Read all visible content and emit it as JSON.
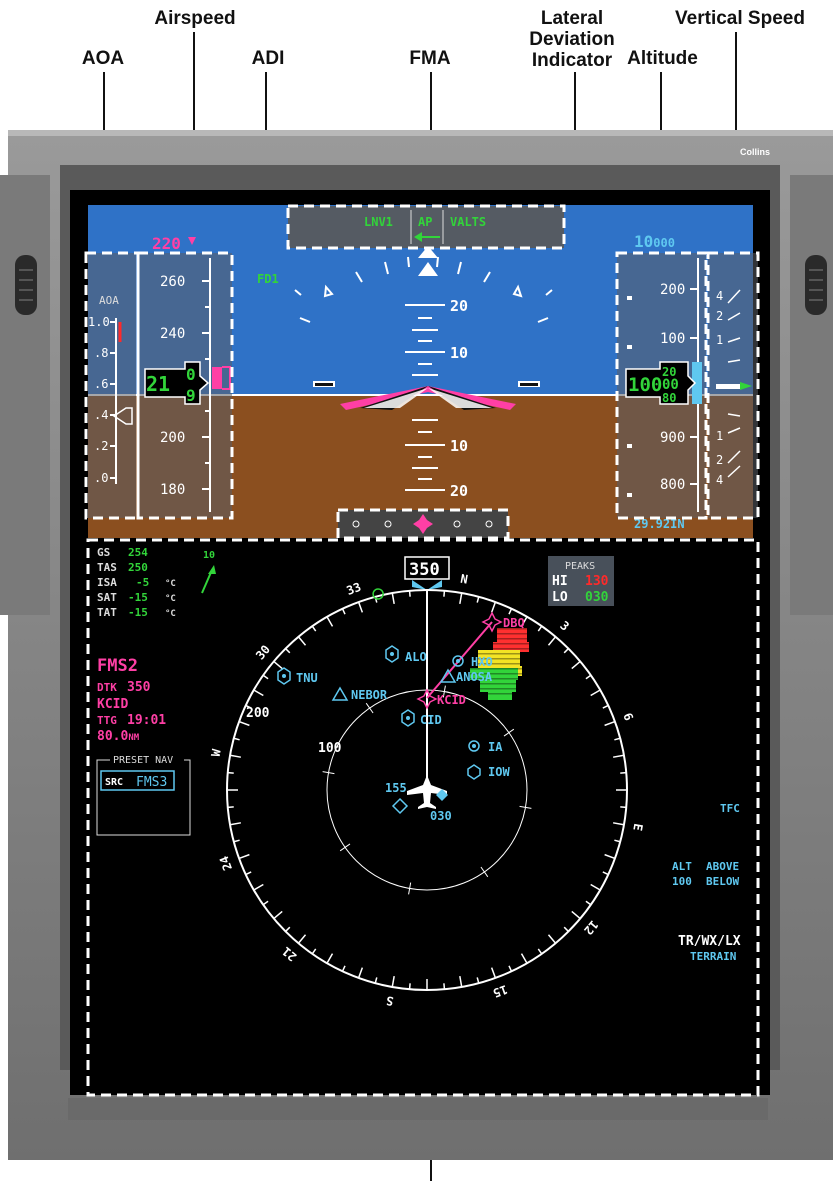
{
  "callouts": {
    "aoa": "AOA",
    "airspeed": "Airspeed",
    "adi": "ADI",
    "fma": "FMA",
    "lateral_deviation": [
      "Lateral",
      "Deviation",
      "Indicator"
    ],
    "altitude": "Altitude",
    "vertical_speed": "Vertical Speed"
  },
  "bezel": {
    "brand": "Collins"
  },
  "fma": {
    "lateral": "LNV1",
    "ap": "AP",
    "vertical": "VALTS"
  },
  "airspeed": {
    "selected": "220",
    "ticks": [
      "260",
      "240",
      "200",
      "180"
    ],
    "current_main": "21",
    "current_roll_top": "0",
    "current_roll_bottom": "9"
  },
  "aoa": {
    "label": "AOA",
    "ticks": [
      "1.0",
      ".8",
      ".6",
      ".4",
      ".2",
      ".0"
    ]
  },
  "adi": {
    "fd": "FD1",
    "pitch_labels": [
      "20",
      "10",
      "10",
      "20"
    ]
  },
  "altitude": {
    "selected_main": "10",
    "selected_small": "000",
    "ticks": [
      "200",
      "100",
      "900",
      "800"
    ],
    "current_main": "100",
    "roll_top": "20",
    "roll_mid": "00",
    "roll_bottom": "80",
    "baro": "29.92IN"
  },
  "vsi": {
    "ticks": [
      "4",
      "2",
      "1",
      "1",
      "2",
      "4"
    ]
  },
  "data_block": {
    "rows": [
      {
        "label": "GS",
        "value": "254",
        "unit": ""
      },
      {
        "label": "TAS",
        "value": "250",
        "unit": ""
      },
      {
        "label": "ISA",
        "value": "-5",
        "unit": "°C"
      },
      {
        "label": "SAT",
        "value": "-15",
        "unit": "°C"
      },
      {
        "label": "TAT",
        "value": "-15",
        "unit": "°C"
      }
    ],
    "wind_speed": "10"
  },
  "fms": {
    "source": "FMS2",
    "dtk_label": "DTK",
    "dtk_value": "350",
    "waypoint": "KCID",
    "ttg_label": "TTG",
    "ttg_value": "19:01",
    "dist_value": "80.0",
    "dist_unit": "NM"
  },
  "preset_nav": {
    "title": "PRESET NAV",
    "src_label": "SRC",
    "src_value": "FMS3"
  },
  "heading": {
    "current": "350"
  },
  "compass_labels": [
    "N",
    "3",
    "6",
    "E",
    "12",
    "15",
    "S",
    "21",
    "24",
    "W",
    "30",
    "33"
  ],
  "range_rings": {
    "outer": "200",
    "inner": "100"
  },
  "peaks": {
    "title": "PEAKS",
    "hi_label": "HI",
    "hi_value": "130",
    "lo_label": "LO",
    "lo_value": "030"
  },
  "waypoints": {
    "dbq": "DBQ",
    "alo": "ALO",
    "tnu": "TNU",
    "hxo": "HXO",
    "anosa": "ANOSA",
    "nebor": "NEBOR",
    "kcid": "KCID",
    "cid": "CID",
    "ia": "IA",
    "iow": "IOW"
  },
  "traffic": {
    "alt": "155",
    "alt2": "030"
  },
  "right_panel": {
    "tfc": "TFC",
    "alt_label": "ALT",
    "alt_above": "ABOVE",
    "alt_value": "100",
    "alt_below": "BELOW",
    "tr": "TR",
    "wx": "/WX/",
    "lx": "LX",
    "terrain": "TERRAIN"
  },
  "colors": {
    "sky": "#2f72c7",
    "ground": "#8b4f1f",
    "magenta": "#ff3fa5",
    "green": "#32d43a",
    "cyan": "#5fc8f0",
    "red": "#ff2a2a",
    "bezel": "#8a8a8a",
    "screen": "#000000"
  }
}
